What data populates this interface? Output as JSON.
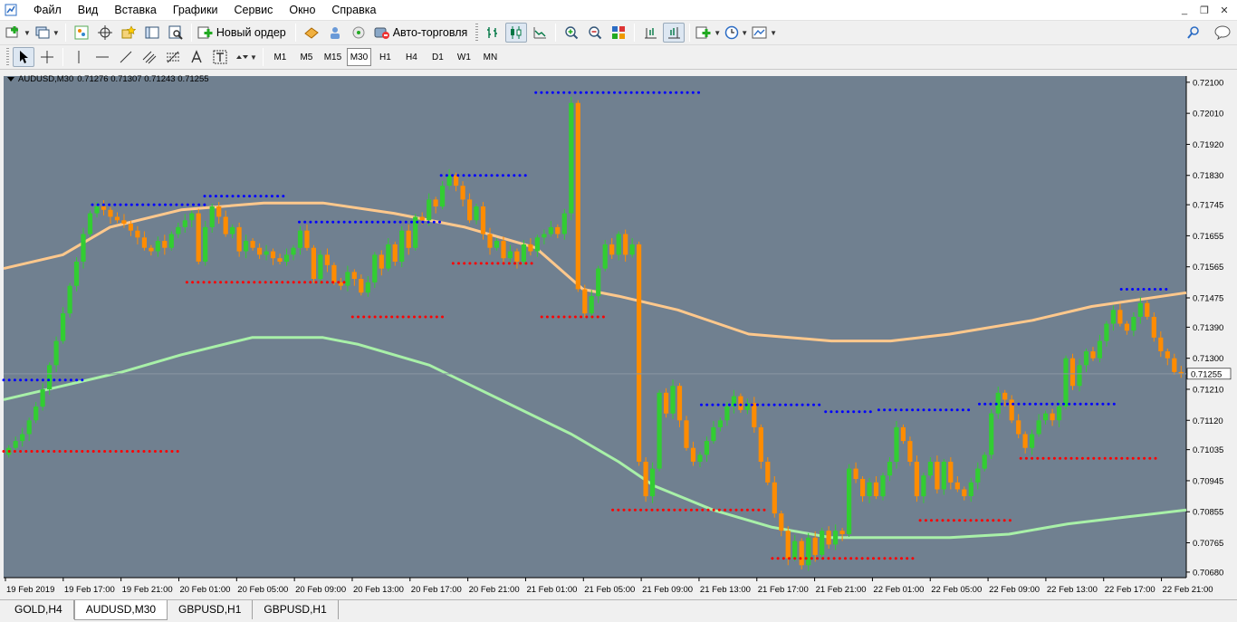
{
  "menu": {
    "items": [
      "Файл",
      "Вид",
      "Вставка",
      "Графики",
      "Сервис",
      "Окно",
      "Справка"
    ],
    "window_controls": [
      "_",
      "❐",
      "✕"
    ]
  },
  "toolbar": {
    "new_order": "Новый ордер",
    "auto_trading": "Авто-торговля"
  },
  "timeframes": {
    "items": [
      "M1",
      "M5",
      "M15",
      "M30",
      "H1",
      "H4",
      "D1",
      "W1",
      "MN"
    ],
    "active": "M30"
  },
  "chart_header": {
    "symbol": "AUDUSD,M30",
    "ohlc": "0.71276 0.71307 0.71243 0.71255"
  },
  "tabs": {
    "items": [
      "GOLD,H4",
      "AUDUSD,M30",
      "GBPUSD,H1",
      "GBPUSD,H1"
    ],
    "active": "AUDUSD,M30"
  },
  "colors": {
    "chart_bg": "#708090",
    "bull": "#32cd32",
    "bear": "#ff8c00",
    "ma_upper": "#ffc88c",
    "ma_lower": "#a8f0a8",
    "resistance_dots": "#0000ff",
    "support_dots": "#ff0000",
    "price_label_bg": "#ffffff"
  },
  "chart_data": {
    "type": "candlestick",
    "symbol": "AUDUSD",
    "timeframe": "M30",
    "current_price": 0.71255,
    "current_price_label": "0.71255",
    "ylim": [
      0.70664,
      0.72118
    ],
    "y_ticks": [
      "0.72100",
      "0.72010",
      "0.71920",
      "0.71830",
      "0.71745",
      "0.71655",
      "0.71565",
      "0.71475",
      "0.71390",
      "0.71300",
      "0.71210",
      "0.71120",
      "0.71035",
      "0.70945",
      "0.70855",
      "0.70765",
      "0.70680"
    ],
    "x_ticks": [
      "19 Feb 2019",
      "19 Feb 17:00",
      "19 Feb 21:00",
      "20 Feb 01:00",
      "20 Feb 05:00",
      "20 Feb 09:00",
      "20 Feb 13:00",
      "20 Feb 17:00",
      "20 Feb 21:00",
      "21 Feb 01:00",
      "21 Feb 05:00",
      "21 Feb 09:00",
      "21 Feb 13:00",
      "21 Feb 17:00",
      "21 Feb 21:00",
      "22 Feb 01:00",
      "22 Feb 05:00",
      "22 Feb 09:00",
      "22 Feb 13:00",
      "22 Feb 17:00",
      "22 Feb 21:00"
    ],
    "closes": [
      0.7104,
      0.7106,
      0.7108,
      0.7112,
      0.7116,
      0.7121,
      0.7128,
      0.7135,
      0.7143,
      0.7151,
      0.7158,
      0.7166,
      0.7172,
      0.7174,
      0.7173,
      0.7171,
      0.717,
      0.7169,
      0.7167,
      0.7165,
      0.7162,
      0.7161,
      0.7164,
      0.7162,
      0.7166,
      0.7168,
      0.717,
      0.7172,
      0.7158,
      0.7168,
      0.7174,
      0.7171,
      0.7166,
      0.7168,
      0.7161,
      0.7164,
      0.7162,
      0.716,
      0.7161,
      0.7159,
      0.7158,
      0.716,
      0.7162,
      0.7167,
      0.7162,
      0.7153,
      0.716,
      0.7157,
      0.7152,
      0.7151,
      0.7155,
      0.7153,
      0.7149,
      0.7152,
      0.716,
      0.7156,
      0.7163,
      0.7158,
      0.7167,
      0.7162,
      0.7171,
      0.717,
      0.7176,
      0.7174,
      0.718,
      0.7183,
      0.718,
      0.7176,
      0.717,
      0.7174,
      0.7166,
      0.7162,
      0.7164,
      0.7159,
      0.7161,
      0.7158,
      0.7163,
      0.7161,
      0.7165,
      0.7166,
      0.7168,
      0.7166,
      0.7172,
      0.7204,
      0.715,
      0.7143,
      0.7148,
      0.7156,
      0.7163,
      0.716,
      0.7166,
      0.716,
      0.7163,
      0.71,
      0.709,
      0.7098,
      0.712,
      0.7114,
      0.7122,
      0.7112,
      0.7104,
      0.71,
      0.7102,
      0.7106,
      0.711,
      0.7112,
      0.7116,
      0.7119,
      0.7115,
      0.7117,
      0.711,
      0.71,
      0.7094,
      0.7085,
      0.708,
      0.7072,
      0.7077,
      0.707,
      0.7078,
      0.7073,
      0.708,
      0.7076,
      0.708,
      0.7079,
      0.7098,
      0.7095,
      0.709,
      0.7094,
      0.709,
      0.7096,
      0.71,
      0.711,
      0.7106,
      0.71,
      0.709,
      0.7096,
      0.71,
      0.7092,
      0.71,
      0.7094,
      0.7092,
      0.709,
      0.7094,
      0.7098,
      0.7102,
      0.7114,
      0.712,
      0.7118,
      0.7112,
      0.7108,
      0.7104,
      0.7108,
      0.7112,
      0.7114,
      0.7112,
      0.7116,
      0.713,
      0.7122,
      0.7128,
      0.7132,
      0.713,
      0.7135,
      0.714,
      0.7144,
      0.714,
      0.7138,
      0.7142,
      0.7146,
      0.7142,
      0.7136,
      0.7132,
      0.713,
      0.7126,
      0.71255
    ],
    "ma_upper": [
      [
        0,
        0.7156
      ],
      [
        0.05,
        0.716
      ],
      [
        0.09,
        0.7168
      ],
      [
        0.15,
        0.7173
      ],
      [
        0.22,
        0.7175
      ],
      [
        0.27,
        0.7175
      ],
      [
        0.33,
        0.7172
      ],
      [
        0.39,
        0.7168
      ],
      [
        0.45,
        0.7162
      ],
      [
        0.49,
        0.715
      ],
      [
        0.52,
        0.7148
      ],
      [
        0.57,
        0.7144
      ],
      [
        0.63,
        0.7137
      ],
      [
        0.7,
        0.7135
      ],
      [
        0.75,
        0.7135
      ],
      [
        0.8,
        0.7137
      ],
      [
        0.87,
        0.7141
      ],
      [
        0.92,
        0.7145
      ],
      [
        1.0,
        0.7149
      ]
    ],
    "ma_lower": [
      [
        0,
        0.7118
      ],
      [
        0.05,
        0.7122
      ],
      [
        0.1,
        0.7126
      ],
      [
        0.15,
        0.7131
      ],
      [
        0.21,
        0.7136
      ],
      [
        0.27,
        0.7136
      ],
      [
        0.3,
        0.7134
      ],
      [
        0.36,
        0.7128
      ],
      [
        0.42,
        0.7118
      ],
      [
        0.48,
        0.7108
      ],
      [
        0.52,
        0.71
      ],
      [
        0.55,
        0.7093
      ],
      [
        0.6,
        0.7086
      ],
      [
        0.65,
        0.7081
      ],
      [
        0.7,
        0.7078
      ],
      [
        0.75,
        0.7078
      ],
      [
        0.8,
        0.7078
      ],
      [
        0.85,
        0.7079
      ],
      [
        0.9,
        0.7082
      ],
      [
        0.95,
        0.7084
      ],
      [
        1.0,
        0.7086
      ]
    ],
    "resistance_levels": [
      [
        0,
        0.07,
        0.71237
      ],
      [
        0.075,
        0.17,
        0.71745
      ],
      [
        0.17,
        0.24,
        0.7177
      ],
      [
        0.25,
        0.37,
        0.71695
      ],
      [
        0.37,
        0.445,
        0.7183
      ],
      [
        0.45,
        0.59,
        0.7207
      ],
      [
        0.59,
        0.69,
        0.71165
      ],
      [
        0.695,
        0.735,
        0.71145
      ],
      [
        0.74,
        0.82,
        0.7115
      ],
      [
        0.825,
        0.94,
        0.71167
      ],
      [
        0.945,
        0.985,
        0.715
      ]
    ],
    "support_levels": [
      [
        0,
        0.15,
        0.7103
      ],
      [
        0.155,
        0.29,
        0.7152
      ],
      [
        0.295,
        0.375,
        0.7142
      ],
      [
        0.38,
        0.45,
        0.71575
      ],
      [
        0.455,
        0.51,
        0.7142
      ],
      [
        0.515,
        0.645,
        0.7086
      ],
      [
        0.65,
        0.77,
        0.7072
      ],
      [
        0.775,
        0.855,
        0.7083
      ],
      [
        0.86,
        0.975,
        0.7101
      ]
    ]
  }
}
